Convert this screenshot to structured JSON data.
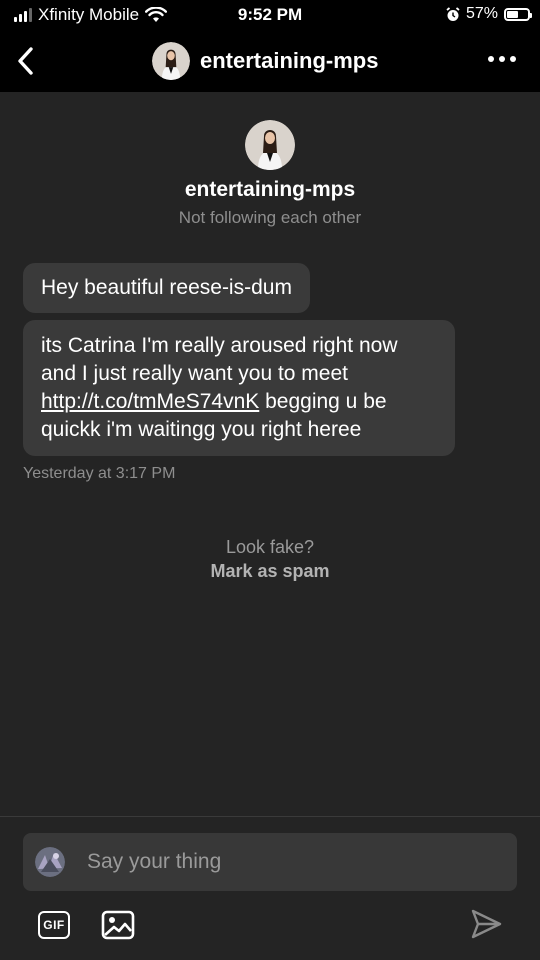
{
  "status_bar": {
    "carrier": "Xfinity Mobile",
    "time": "9:52 PM",
    "battery": "57%",
    "battery_level": 0.57
  },
  "header": {
    "title": "entertaining-mps",
    "back_icon": "chevron-left-icon",
    "more_icon": "more-horizontal-icon"
  },
  "profile": {
    "name": "entertaining-mps",
    "relationship": "Not following each other"
  },
  "messages": [
    {
      "text": "Hey beautiful reese-is-dum"
    },
    {
      "text_before": "its Catrina I'm really aroused right now and I just really want you to meet ",
      "link": "http://t.co/tmMeS74vnK",
      "text_after": " begging u be quickk i'm waitingg you right heree"
    }
  ],
  "timestamp": "Yesterday at 3:17 PM",
  "spam": {
    "question": "Look fake?",
    "action": "Mark as spam"
  },
  "composer": {
    "placeholder": "Say your thing",
    "gif_label": "GIF",
    "image_icon": "image-icon",
    "send_icon": "send-icon"
  },
  "colors": {
    "background": "#242424",
    "bars": "#000000",
    "bubble": "#3a3a3a",
    "muted_text": "#8e8e8e"
  }
}
